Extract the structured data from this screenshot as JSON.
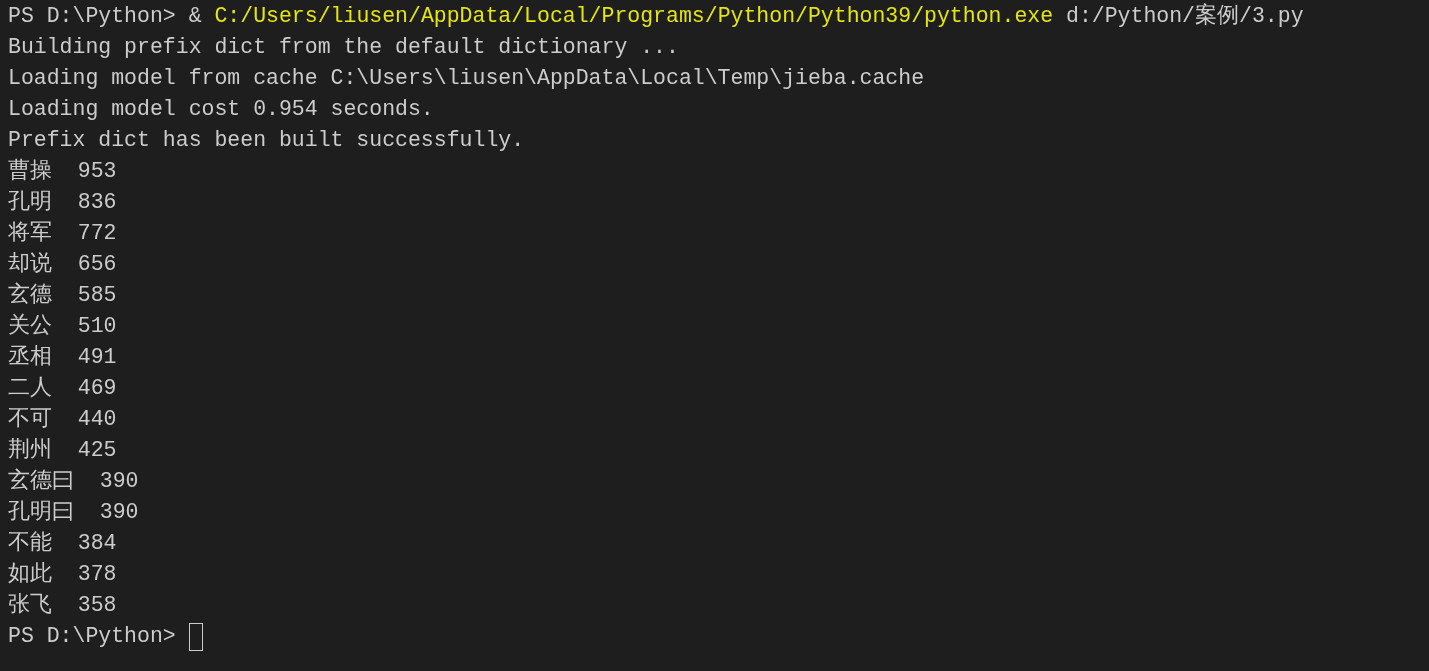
{
  "terminal": {
    "command": {
      "prompt": "PS D:\\Python> ",
      "operator": "&",
      "executable": "C:/Users/liusen/AppData/Local/Programs/Python/Python39/python.exe",
      "argument": "d:/Python/案例/3.py"
    },
    "output": [
      "Building prefix dict from the default dictionary ...",
      "Loading model from cache C:\\Users\\liusen\\AppData\\Local\\Temp\\jieba.cache",
      "Loading model cost 0.954 seconds.",
      "Prefix dict has been built successfully.",
      "曹操  953",
      "孔明  836",
      "将军  772",
      "却说  656",
      "玄德  585",
      "关公  510",
      "丞相  491",
      "二人  469",
      "不可  440",
      "荆州  425",
      "玄德曰  390",
      "孔明曰  390",
      "不能  384",
      "如此  378",
      "张飞  358"
    ],
    "prompt": {
      "text": "PS D:\\Python>",
      "cursor": true
    }
  }
}
